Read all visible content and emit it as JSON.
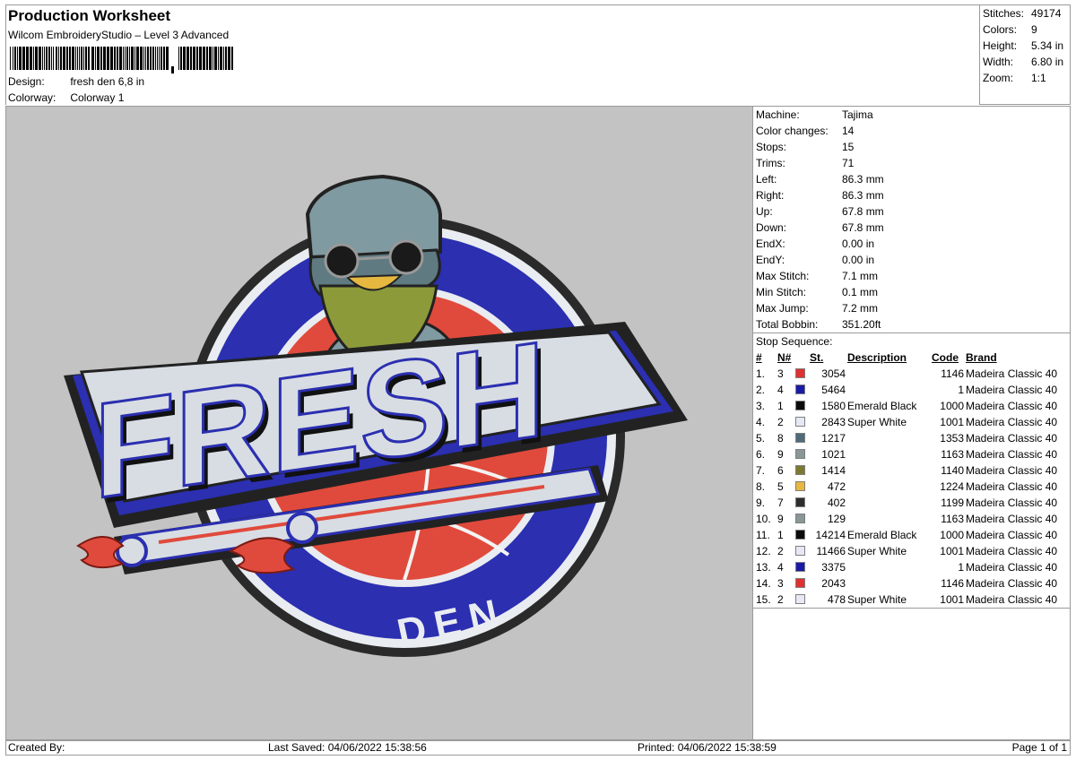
{
  "header": {
    "title": "Production Worksheet",
    "software": "Wilcom EmbroideryStudio – Level 3 Advanced",
    "design_label": "Design:",
    "design_value": "fresh den 6,8 in",
    "colorway_label": "Colorway:",
    "colorway_value": "Colorway 1"
  },
  "summary": {
    "stitches_label": "Stitches:",
    "stitches_value": "49174",
    "colors_label": "Colors:",
    "colors_value": "9",
    "height_label": "Height:",
    "height_value": "5.34 in",
    "width_label": "Width:",
    "width_value": "6.80 in",
    "zoom_label": "Zoom:",
    "zoom_value": "1:1"
  },
  "properties": [
    {
      "label": "Machine:",
      "value": "Tajima"
    },
    {
      "label": "Color changes:",
      "value": "14"
    },
    {
      "label": "Stops:",
      "value": "15"
    },
    {
      "label": "Trims:",
      "value": "71"
    },
    {
      "label": "Left:",
      "value": "86.3 mm"
    },
    {
      "label": "Right:",
      "value": "86.3 mm"
    },
    {
      "label": "Up:",
      "value": "67.8 mm"
    },
    {
      "label": "Down:",
      "value": "67.8 mm"
    },
    {
      "label": "EndX:",
      "value": "0.00 in"
    },
    {
      "label": "EndY:",
      "value": "0.00 in"
    },
    {
      "label": "Max Stitch:",
      "value": "7.1 mm"
    },
    {
      "label": "Min Stitch:",
      "value": "0.1 mm"
    },
    {
      "label": "Max Jump:",
      "value": "7.2 mm"
    },
    {
      "label": "Total Bobbin:",
      "value": "351.20ft"
    }
  ],
  "stop_sequence": {
    "title": "Stop Sequence:",
    "columns": {
      "num": "#",
      "n": "N#",
      "st": "St.",
      "description": "Description",
      "code": "Code",
      "brand": "Brand"
    },
    "rows": [
      {
        "num": "1.",
        "n": "3",
        "color": "#e03030",
        "st": "3054",
        "description": "",
        "code": "1146",
        "brand": "Madeira Classic 40"
      },
      {
        "num": "2.",
        "n": "4",
        "color": "#1a1aa8",
        "st": "5464",
        "description": "",
        "code": "1",
        "brand": "Madeira Classic 40"
      },
      {
        "num": "3.",
        "n": "1",
        "color": "#0a0a0a",
        "st": "1580",
        "description": "Emerald Black",
        "code": "1000",
        "brand": "Madeira Classic 40"
      },
      {
        "num": "4.",
        "n": "2",
        "color": "#e6e8f4",
        "st": "2843",
        "description": "Super White",
        "code": "1001",
        "brand": "Madeira Classic 40"
      },
      {
        "num": "5.",
        "n": "8",
        "color": "#4f6b78",
        "st": "1217",
        "description": "",
        "code": "1353",
        "brand": "Madeira Classic 40"
      },
      {
        "num": "6.",
        "n": "9",
        "color": "#8a9698",
        "st": "1021",
        "description": "",
        "code": "1163",
        "brand": "Madeira Classic 40"
      },
      {
        "num": "7.",
        "n": "6",
        "color": "#7c7a2e",
        "st": "1414",
        "description": "",
        "code": "1140",
        "brand": "Madeira Classic 40"
      },
      {
        "num": "8.",
        "n": "5",
        "color": "#e6b840",
        "st": "472",
        "description": "",
        "code": "1224",
        "brand": "Madeira Classic 40"
      },
      {
        "num": "9.",
        "n": "7",
        "color": "#2e2e2e",
        "st": "402",
        "description": "",
        "code": "1199",
        "brand": "Madeira Classic 40"
      },
      {
        "num": "10.",
        "n": "9",
        "color": "#8a9698",
        "st": "129",
        "description": "",
        "code": "1163",
        "brand": "Madeira Classic 40"
      },
      {
        "num": "11.",
        "n": "1",
        "color": "#0a0a0a",
        "st": "14214",
        "description": "Emerald Black",
        "code": "1000",
        "brand": "Madeira Classic 40"
      },
      {
        "num": "12.",
        "n": "2",
        "color": "#e6e8f4",
        "st": "11466",
        "description": "Super White",
        "code": "1001",
        "brand": "Madeira Classic 40"
      },
      {
        "num": "13.",
        "n": "4",
        "color": "#1a1aa8",
        "st": "3375",
        "description": "",
        "code": "1",
        "brand": "Madeira Classic 40"
      },
      {
        "num": "14.",
        "n": "3",
        "color": "#e03030",
        "st": "2043",
        "description": "",
        "code": "1146",
        "brand": "Madeira Classic 40"
      },
      {
        "num": "15.",
        "n": "2",
        "color": "#e6e8f4",
        "st": "478",
        "description": "Super White",
        "code": "1001",
        "brand": "Madeira Classic 40"
      }
    ]
  },
  "design_preview": {
    "main_text": "FRESH",
    "sub_text": "DEN",
    "colors": {
      "background": "#c3c3c3",
      "blue": "#2b2fb0",
      "red": "#e04a3c",
      "white": "#e9ecf0",
      "black": "#111111",
      "grey": "#7f9aa0",
      "beard": "#8c9a3a"
    }
  },
  "footer": {
    "created_by": "Created By:",
    "last_saved": "Last Saved: 04/06/2022 15:38:56",
    "printed": "Printed: 04/06/2022 15:38:59",
    "page": "Page 1 of 1"
  }
}
